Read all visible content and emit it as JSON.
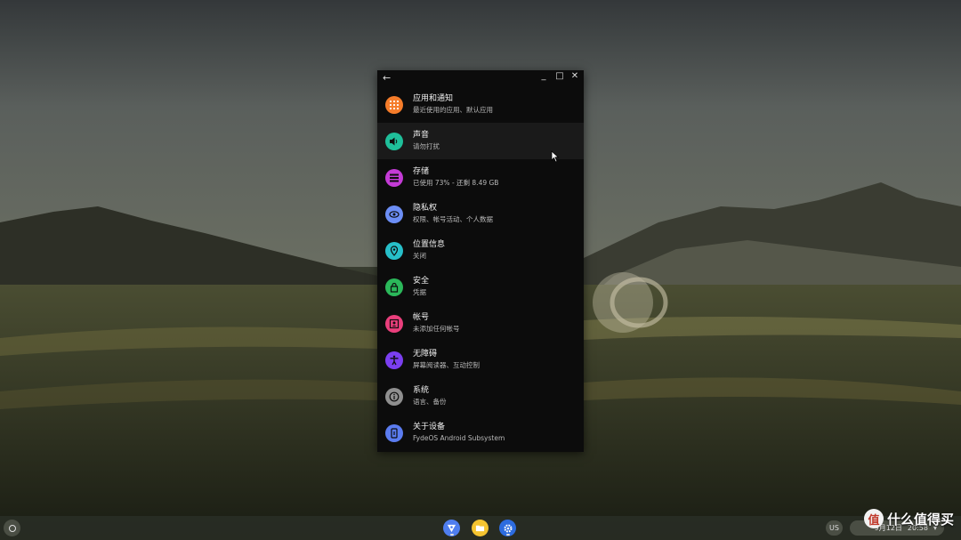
{
  "window": {
    "back_icon": "←",
    "minimize_icon": "_",
    "maximize_icon": "□",
    "close_icon": "✕"
  },
  "settings": {
    "items": [
      {
        "title": "应用和通知",
        "subtitle": "最近使用的应用、默认应用",
        "icon": "apps-grid-icon",
        "color": "#f57c2a"
      },
      {
        "title": "声音",
        "subtitle": "请勿打扰",
        "icon": "volume-icon",
        "color": "#1fbf9a"
      },
      {
        "title": "存储",
        "subtitle": "已使用 73% - 还剩 8.49 GB",
        "icon": "storage-icon",
        "color": "#c43bd6"
      },
      {
        "title": "隐私权",
        "subtitle": "权限、帐号活动、个人数据",
        "icon": "privacy-eye-icon",
        "color": "#6c8ef5"
      },
      {
        "title": "位置信息",
        "subtitle": "关闭",
        "icon": "location-pin-icon",
        "color": "#27bfc9"
      },
      {
        "title": "安全",
        "subtitle": "凭据",
        "icon": "lock-icon",
        "color": "#2bb85a"
      },
      {
        "title": "帐号",
        "subtitle": "未添加任何帐号",
        "icon": "account-box-icon",
        "color": "#ea3f7c"
      },
      {
        "title": "无障碍",
        "subtitle": "屏幕阅读器、互动控制",
        "icon": "accessibility-icon",
        "color": "#7b3ff0"
      },
      {
        "title": "系统",
        "subtitle": "语言、备份",
        "icon": "info-icon",
        "color": "#8f8f8f"
      },
      {
        "title": "关于设备",
        "subtitle": "FydeOS Android Subsystem",
        "icon": "device-icon",
        "color": "#5b7cf0"
      }
    ]
  },
  "shelf": {
    "ime": "US",
    "date": "9月12日",
    "time": "20:58"
  },
  "watermark": {
    "logo": "值",
    "text": "什么值得买"
  }
}
